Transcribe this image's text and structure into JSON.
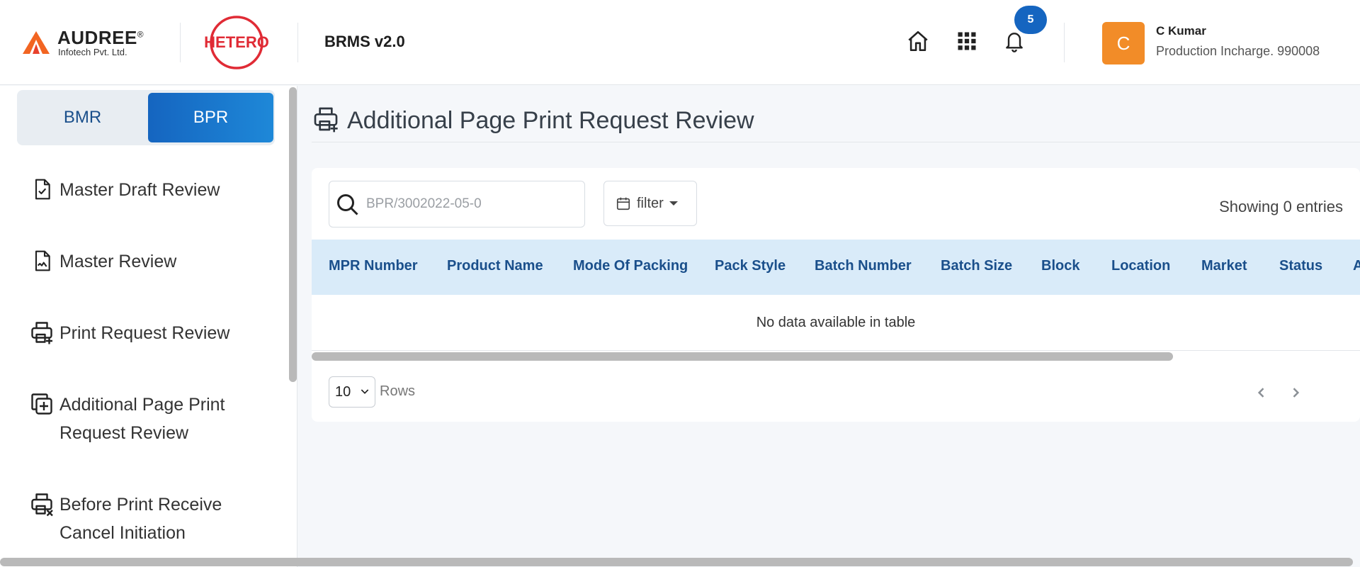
{
  "brand": {
    "company_name": "AUDREE",
    "registered_mark": "®",
    "company_sub": "Infotech Pvt. Ltd.",
    "client_logo_text": "HETERO",
    "app_title": "BRMS v2.0"
  },
  "header": {
    "icons": [
      "home-icon",
      "apps-grid-icon",
      "bell-icon"
    ],
    "notification_count": "5",
    "user": {
      "initial": "C",
      "name": "C Kumar",
      "role": "Production Incharge. 990008"
    },
    "colors": {
      "badge": "#1565c0",
      "avatar": "#f28c28"
    }
  },
  "sidebar": {
    "toggle": {
      "bmr": "BMR",
      "bpr": "BPR",
      "active": "BPR"
    },
    "items": [
      {
        "label": "Master Draft Review",
        "icon": "document-check-icon"
      },
      {
        "label": "Master Review",
        "icon": "document-signature-icon"
      },
      {
        "label": "Print Request Review",
        "icon": "printer-plus-icon"
      },
      {
        "label": "Additional Page Print Request Review",
        "icon": "copy-plus-icon"
      },
      {
        "label": "Before Print Receive Cancel Initiation",
        "icon": "printer-cancel-icon"
      }
    ]
  },
  "main": {
    "page_title": "Additional Page Print Request Review",
    "search": {
      "placeholder": "BPR/3002022-05-0",
      "value": ""
    },
    "filter_label": "filter",
    "entries_text": "Showing 0 entries",
    "table": {
      "columns": [
        "MPR Number",
        "Product Name",
        "Mode Of Packing",
        "Pack Style",
        "Batch Number",
        "Batch Size",
        "Block",
        "Location",
        "Market",
        "Status",
        "A"
      ],
      "empty_text": "No data available in table"
    },
    "pagination": {
      "rows_value": "10",
      "rows_label": "Rows"
    }
  }
}
